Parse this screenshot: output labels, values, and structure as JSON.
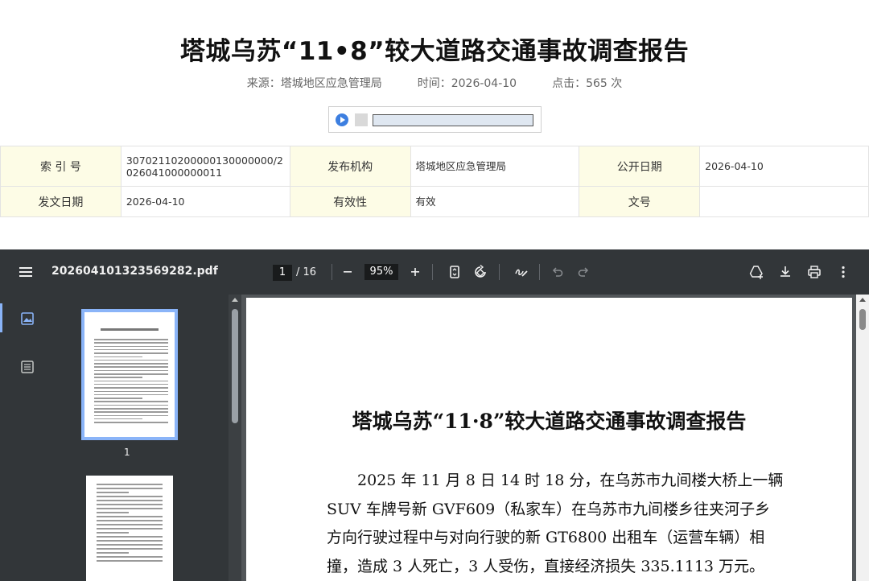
{
  "article": {
    "title": "塔城乌苏“11•8”较大道路交通事故调查报告",
    "source": "来源：塔城地区应急管理局",
    "time": "时间：2026-04-10",
    "clicks": "点击：565 次"
  },
  "info_table": {
    "index_label": "索 引 号",
    "index_value": "30702110200000130000000/2026041000000011",
    "publisher_label": "发布机构",
    "publisher_value": "塔城地区应急管理局",
    "open_date_label": "公开日期",
    "open_date_value": "2026-04-10",
    "issue_date_label": "发文日期",
    "issue_date_value": "2026-04-10",
    "validity_label": "有效性",
    "validity_value": "有效",
    "doc_no_label": "文号",
    "doc_no_value": ""
  },
  "pdf_viewer": {
    "filename": "202604101323569282.pdf",
    "current_page": "1",
    "total_pages": "/ 16",
    "zoom": "95%",
    "thumbnail_1_label": "1",
    "icons": [
      "menu-icon",
      "zoom-out-icon",
      "zoom-in-icon",
      "fit-page-icon",
      "rotate-icon",
      "annotate-icon",
      "undo-icon",
      "redo-icon",
      "drive-icon",
      "download-icon",
      "print-icon",
      "more-icon",
      "thumbnails-icon",
      "outline-icon"
    ]
  },
  "document": {
    "title": "塔城乌苏“11·8”较大道路交通事故调查报告",
    "lines": [
      "　　2025 年 11 月 8 日 14 时 18 分，在乌苏市九间楼大桥上一辆",
      "SUV 车牌号新 GVF609（私家车）在乌苏市九间楼乡往夹河子乡",
      "方向行驶过程中与对向行驶的新 GT6800 出租车（运营车辆）相",
      "撞，造成 3 人死亡，3 人受伤，直接经济损失 335.1113 万元。"
    ]
  }
}
